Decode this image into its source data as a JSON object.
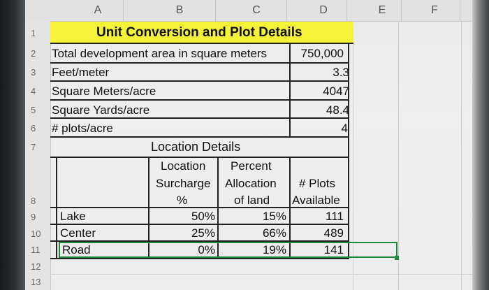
{
  "columns": [
    "A",
    "B",
    "C",
    "D",
    "E",
    "F"
  ],
  "rows": [
    "1",
    "2",
    "3",
    "4",
    "5",
    "6",
    "7",
    "8",
    "9",
    "10",
    "11",
    "12",
    "13"
  ],
  "title": "Unit Conversion and Plot Details",
  "params": [
    {
      "label": "Total development area in square meters",
      "value": "750,000"
    },
    {
      "label": "Feet/meter",
      "value": "3.3"
    },
    {
      "label": "Square Meters/acre",
      "value": "4047"
    },
    {
      "label": "Square Yards/acre",
      "value": "48.4"
    },
    {
      "label": "# plots/acre",
      "value": "4"
    }
  ],
  "location_title": "Location Details",
  "headers": {
    "surcharge": [
      "Location",
      "Surcharge",
      "%"
    ],
    "allocation": [
      "Percent",
      "Allocation",
      "of land"
    ],
    "plots": [
      "# Plots",
      "Available"
    ]
  },
  "locations": [
    {
      "name": "Lake",
      "surcharge": "50%",
      "allocation": "15%",
      "plots": "111"
    },
    {
      "name": "Center",
      "surcharge": "25%",
      "allocation": "66%",
      "plots": "489"
    },
    {
      "name": "Road",
      "surcharge": "0%",
      "allocation": "19%",
      "plots": "141"
    }
  ],
  "colors": {
    "title_fill": "#f5f23a",
    "selection": "#1e8a3e"
  }
}
